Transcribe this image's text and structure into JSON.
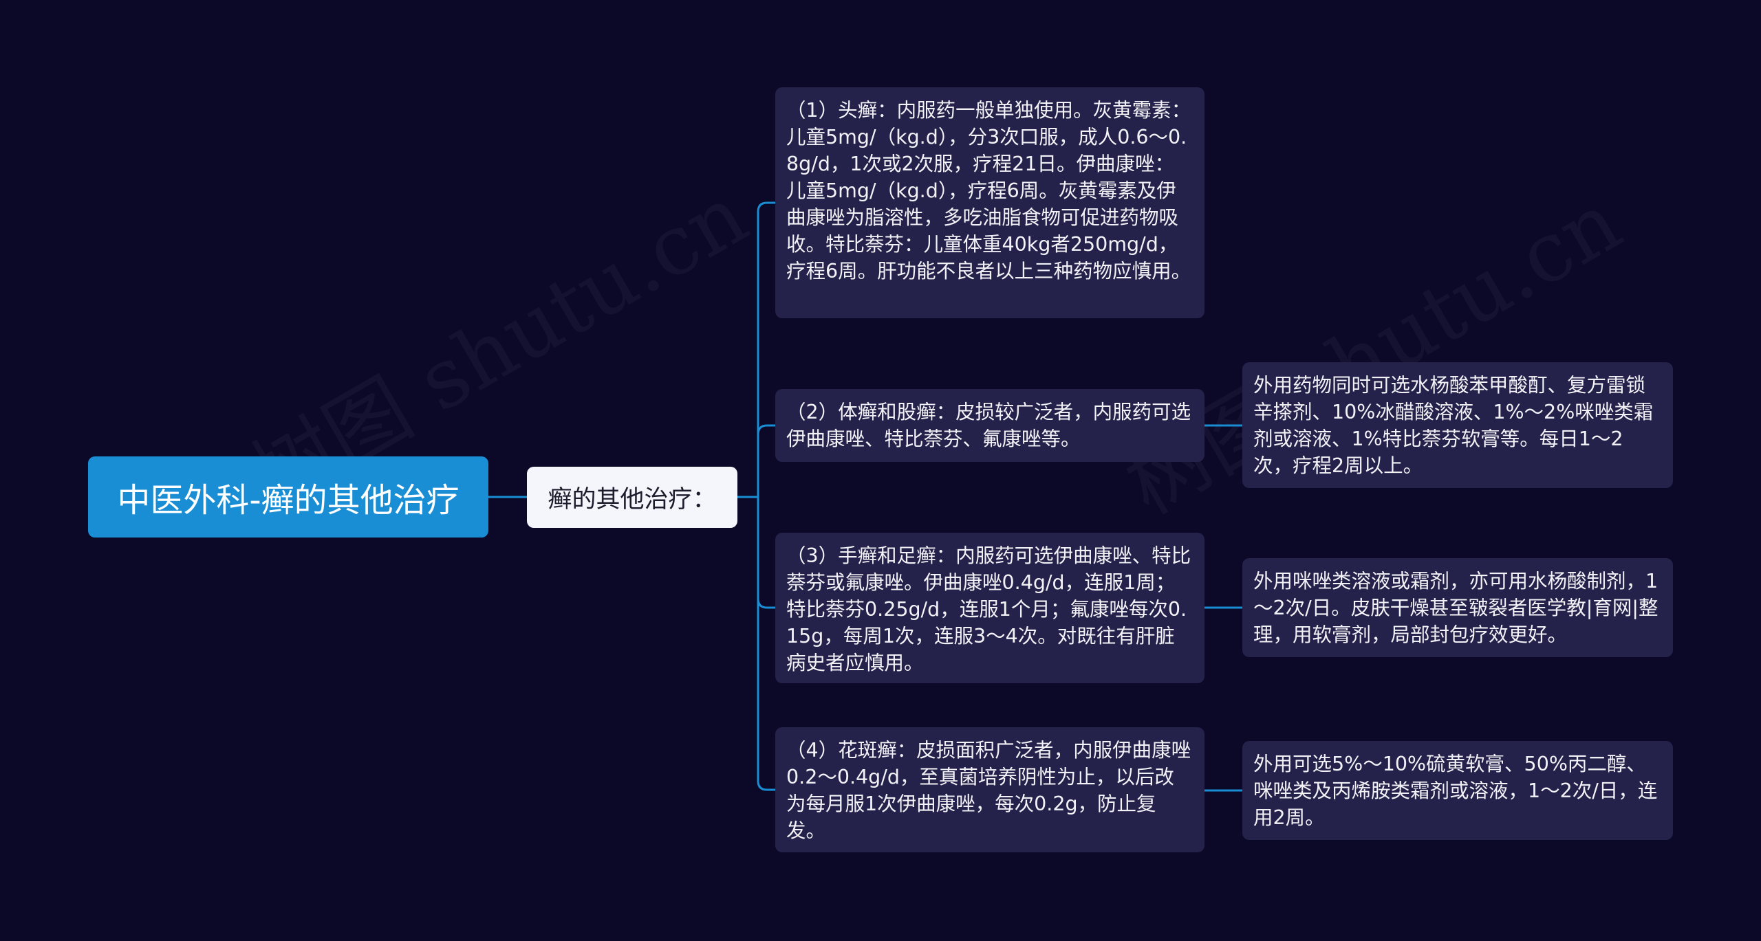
{
  "colors": {
    "background": "#0b0828",
    "root_fill": "#1a8ed4",
    "sub_fill": "#f4f6fb",
    "card_fill": "#24214a",
    "connector": "#1a8ed4"
  },
  "watermark": "树图 shutu.cn",
  "root": {
    "text": "中医外科-癣的其他治疗"
  },
  "sub": {
    "text": "癣的其他治疗："
  },
  "branches": [
    {
      "text": "（1）头癣：内服药一般单独使用。灰黄霉素：儿童5mg/（kg.d），分3次口服，成人0.6～0.8g/d，1次或2次服，疗程21日。伊曲康唑：儿童5mg/（kg.d），疗程6周。灰黄霉素及伊曲康唑为脂溶性，多吃油脂食物可促进药物吸收。特比萘芬：儿童体重40kg者250mg/d，疗程6周。肝功能不良者以上三种药物应慎用。"
    },
    {
      "text": "（2）体癣和股癣：皮损较广泛者，内服药可选伊曲康唑、特比萘芬、氟康唑等。",
      "child": "外用药物同时可选水杨酸苯甲酸酊、复方雷锁辛搽剂、10%冰醋酸溶液、1%～2%咪唑类霜剂或溶液、1%特比萘芬软膏等。每日1～2次，疗程2周以上。"
    },
    {
      "text": "（3）手癣和足癣：内服药可选伊曲康唑、特比萘芬或氟康唑。伊曲康唑0.4g/d，连服1周；特比萘芬0.25g/d，连服1个月；氟康唑每次0.15g，每周1次，连服3～4次。对既往有肝脏病史者应慎用。",
      "child": "外用咪唑类溶液或霜剂，亦可用水杨酸制剂，1～2次/日。皮肤干燥甚至皲裂者医学教|育网|整理，用软膏剂，局部封包疗效更好。"
    },
    {
      "text": "（4）花斑癣：皮损面积广泛者，内服伊曲康唑0.2～0.4g/d，至真菌培养阴性为止，以后改为每月服1次伊曲康唑，每次0.2g，防止复发。",
      "child": "外用可选5%～10%硫黄软膏、50%丙二醇、咪唑类及丙烯胺类霜剂或溶液，1～2次/日，连用2周。"
    }
  ]
}
